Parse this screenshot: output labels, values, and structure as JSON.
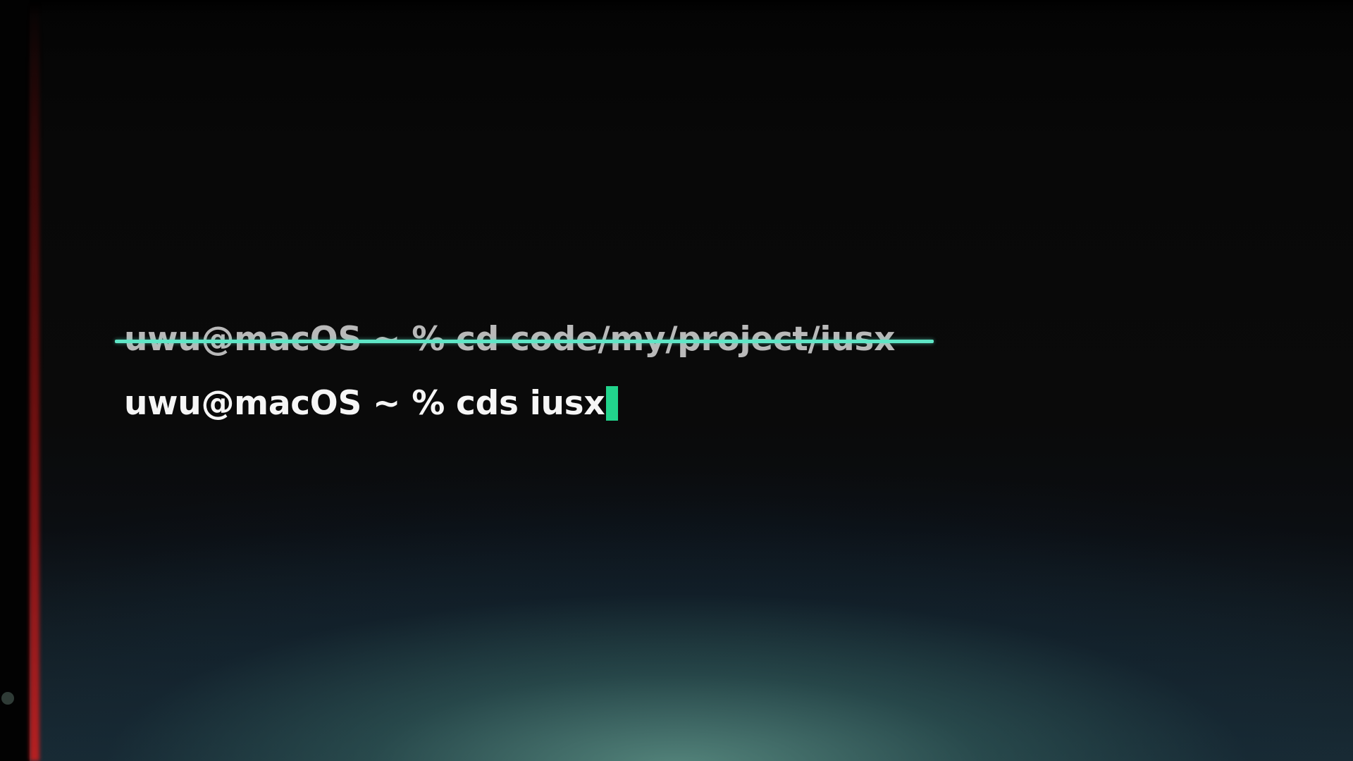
{
  "terminal": {
    "previous_command": "uwu@macOS ~ % cd code/my/project/iusx",
    "current_command": "uwu@macOS ~ % cds iusx"
  },
  "colors": {
    "strike": "#5fe6c6",
    "cursor": "#22d48c",
    "text": "#f6f6f6",
    "background": "#070707"
  }
}
